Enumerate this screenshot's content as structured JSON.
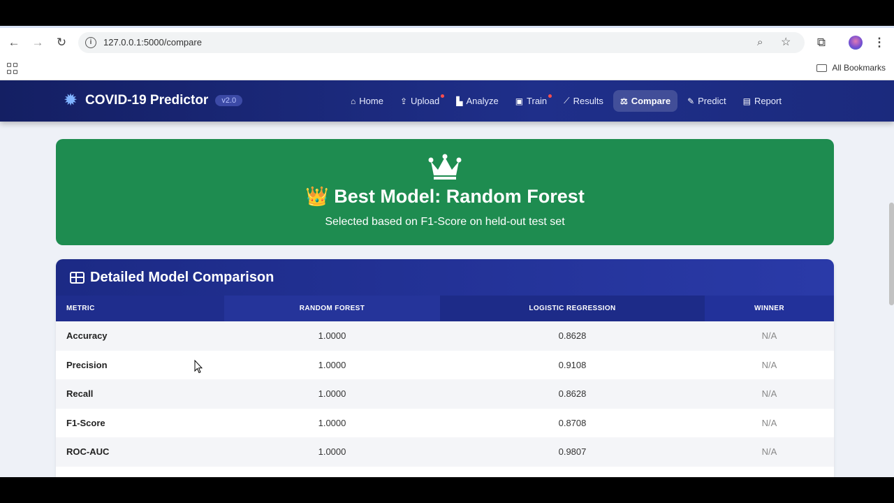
{
  "browser": {
    "url": "127.0.0.1:5000/compare",
    "bookmarks_label": "All Bookmarks"
  },
  "navbar": {
    "brand": "COVID-19 Predictor",
    "version": "v2.0",
    "items": [
      {
        "label": "Home",
        "icon": "home-icon"
      },
      {
        "label": "Upload",
        "icon": "upload-icon",
        "dot": true
      },
      {
        "label": "Analyze",
        "icon": "chart-icon"
      },
      {
        "label": "Train",
        "icon": "robot-icon",
        "dot": true
      },
      {
        "label": "Results",
        "icon": "line-chart-icon"
      },
      {
        "label": "Compare",
        "icon": "scale-icon",
        "active": true
      },
      {
        "label": "Predict",
        "icon": "pencil-icon"
      },
      {
        "label": "Report",
        "icon": "file-icon"
      }
    ]
  },
  "hero": {
    "title": "👑 Best Model: Random Forest",
    "subtitle": "Selected based on F1-Score on held-out test set",
    "color": "#1e8c50"
  },
  "comparison": {
    "title": "Detailed Model Comparison",
    "headers": [
      "METRIC",
      "RANDOM FOREST",
      "LOGISTIC REGRESSION",
      "WINNER"
    ],
    "rows": [
      [
        "Accuracy",
        "1.0000",
        "0.8628",
        "N/A"
      ],
      [
        "Precision",
        "1.0000",
        "0.9108",
        "N/A"
      ],
      [
        "Recall",
        "1.0000",
        "0.8628",
        "N/A"
      ],
      [
        "F1-Score",
        "1.0000",
        "0.8708",
        "N/A"
      ],
      [
        "ROC-AUC",
        "1.0000",
        "0.9807",
        "N/A"
      ]
    ]
  }
}
